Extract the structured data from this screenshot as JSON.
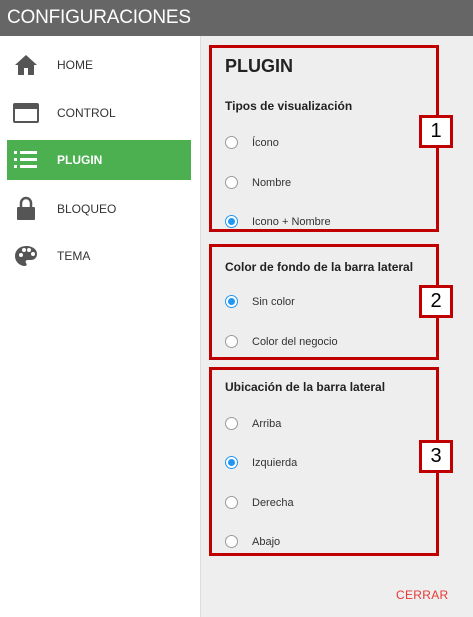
{
  "header": {
    "title": "CONFIGURACIONES"
  },
  "sidebar": {
    "items": [
      {
        "label": "HOME",
        "icon": "home-icon"
      },
      {
        "label": "CONTROL",
        "icon": "window-icon"
      },
      {
        "label": "PLUGIN",
        "icon": "list-icon",
        "active": true
      },
      {
        "label": "BLOQUEO",
        "icon": "lock-icon"
      },
      {
        "label": "TEMA",
        "icon": "palette-icon"
      }
    ],
    "active_color": "#4caf50"
  },
  "main": {
    "section_title": "PLUGIN",
    "groups": [
      {
        "title": "Tipos de visualización",
        "badge": "1",
        "options": [
          {
            "label": "Ícono",
            "checked": false
          },
          {
            "label": "Nombre",
            "checked": false
          },
          {
            "label": "Icono + Nombre",
            "checked": true
          }
        ]
      },
      {
        "title": "Color de fondo de la barra lateral",
        "badge": "2",
        "options": [
          {
            "label": "Sin color",
            "checked": true
          },
          {
            "label": "Color del negocio",
            "checked": false
          }
        ]
      },
      {
        "title": "Ubicación de la barra lateral",
        "badge": "3",
        "options": [
          {
            "label": "Arriba",
            "checked": false
          },
          {
            "label": "Izquierda",
            "checked": true
          },
          {
            "label": "Derecha",
            "checked": false
          },
          {
            "label": "Abajo",
            "checked": false
          }
        ]
      }
    ],
    "cancel_label": "CERRAR"
  },
  "colors": {
    "titlebar": "#666666",
    "highlight_border": "#c00000",
    "radio_checked": "#2196f3",
    "cancel": "#e53935"
  }
}
